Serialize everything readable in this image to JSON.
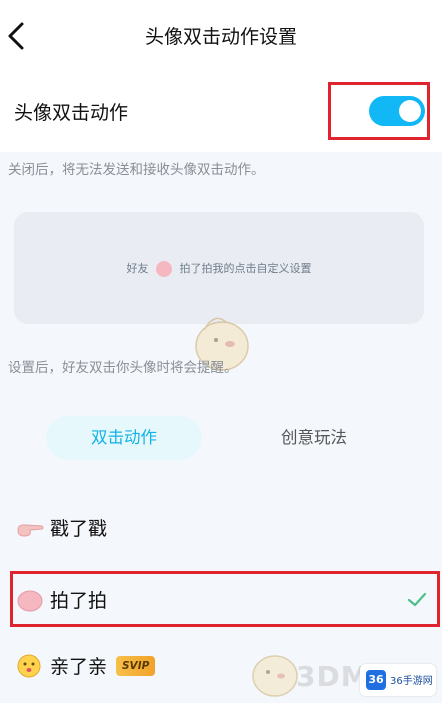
{
  "header": {
    "title": "头像双击动作设置"
  },
  "toggle_row": {
    "label": "头像双击动作",
    "enabled": true
  },
  "desc_off": "关闭后，将无法发送和接收头像双击动作。",
  "preview": {
    "prefix": "好友",
    "text": "拍了拍我的点击自定义设置"
  },
  "desc_set": "设置后，好友双击你头像时将会提醒。",
  "tabs": [
    "双击动作",
    "创意玩法"
  ],
  "actions": [
    {
      "label": "戳了戳",
      "selected": false
    },
    {
      "label": "拍了拍",
      "selected": true
    },
    {
      "label": "亲了亲",
      "badge": "SVIP",
      "selected": false
    }
  ],
  "watermark": {
    "site": "3DM",
    "brand": "36手游网",
    "brand_mark": "36"
  },
  "colors": {
    "accent": "#12b7f5",
    "highlight": "#e0242f",
    "svip": "#f7c04a"
  }
}
